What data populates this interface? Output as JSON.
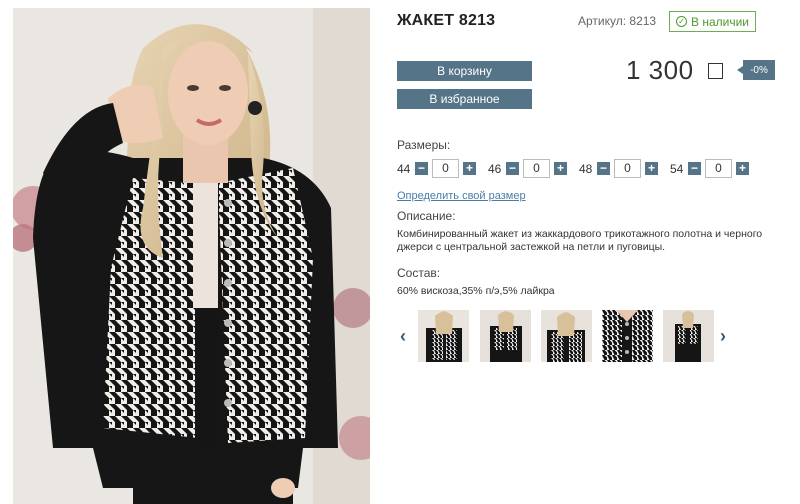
{
  "product": {
    "title": "ЖАКЕТ 8213",
    "sku_label": "Артикул: 8213",
    "stock_label": "В наличии",
    "price": "1 300",
    "discount": "-0%"
  },
  "buttons": {
    "cart": "В корзину",
    "favorites": "В избранное"
  },
  "sizes": {
    "label": "Размеры:",
    "items": [
      {
        "size": "44",
        "qty": "0"
      },
      {
        "size": "46",
        "qty": "0"
      },
      {
        "size": "48",
        "qty": "0"
      },
      {
        "size": "54",
        "qty": "0"
      }
    ],
    "minus": "−",
    "plus": "+",
    "size_link": "Определить свой размер"
  },
  "description": {
    "label": "Описание:",
    "text": "Комбинированный жакет из жаккардового трикотажного полотна и черного джерси с центральной застежкой на петли и пуговицы."
  },
  "composition": {
    "label": "Состав:",
    "text": "60% вискоза,35% п/э,5% лайкра"
  },
  "gallery": {
    "prev": "‹",
    "next": "›",
    "thumbnails": [
      "thumb-1",
      "thumb-2",
      "thumb-3",
      "thumb-4",
      "thumb-5"
    ]
  },
  "colors": {
    "accent": "#557488",
    "stock_green": "#4f9a2f",
    "link": "#4a7ca8"
  },
  "icons": {
    "stock": "check-circle-icon",
    "currency": "ruble-box-icon",
    "prev": "chevron-left-icon",
    "next": "chevron-right-icon"
  }
}
